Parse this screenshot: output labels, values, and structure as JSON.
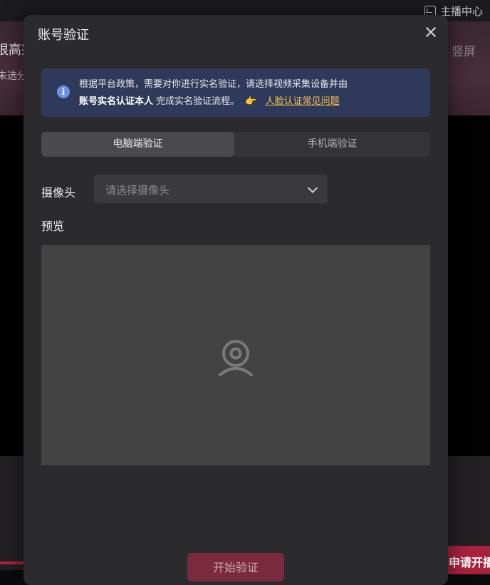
{
  "background": {
    "streamer_center_label": "主播中心",
    "title_fragment": "很高兴",
    "subtitle_fragment": "未选分",
    "portrait_tab": "竖屏",
    "apply_button": "申请开播"
  },
  "modal": {
    "title": "账号验证",
    "notice": {
      "line1": "根据平台政策，需要对你进行实名验证，请选择视频采集设备并由",
      "bold": "账号实名认证本人",
      "line2": "完成实名验证流程。",
      "hand_emoji": "👉",
      "faq_link": "人脸认证常见问题"
    },
    "tabs": [
      {
        "label": "电脑端验证",
        "active": true
      },
      {
        "label": "手机端验证",
        "active": false
      }
    ],
    "camera": {
      "label": "摄像头",
      "placeholder": "请选择摄像头"
    },
    "preview_label": "预览",
    "start_button": "开始验证"
  },
  "colors": {
    "accent_link": "#f2c14e",
    "notice_bg": "#2f3a5a",
    "button": "#7a2a3c"
  },
  "icons": [
    "monitor-chart-icon",
    "close-icon",
    "info-icon",
    "hand-pointing-icon",
    "chevron-down-icon",
    "webcam-icon"
  ]
}
